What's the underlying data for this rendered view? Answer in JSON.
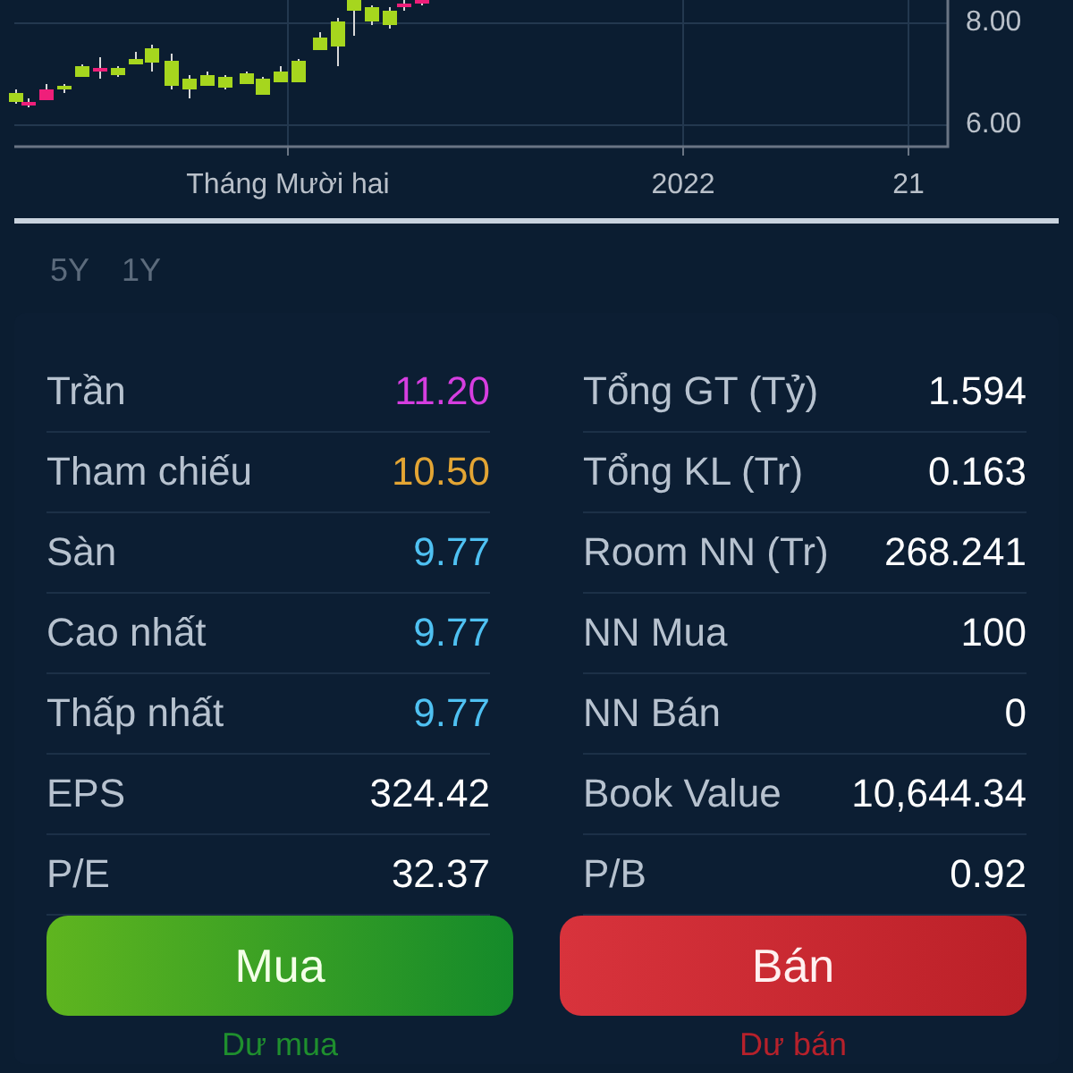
{
  "chart": {
    "y_labels": [
      "8.00",
      "6.00"
    ],
    "x_labels": [
      "Tháng Mười hai",
      "2022",
      "21"
    ]
  },
  "range_tabs": [
    {
      "label": "5Y",
      "selected": false
    },
    {
      "label": "1Y",
      "selected": false
    }
  ],
  "stats": [
    {
      "left": {
        "label": "Trần",
        "value": "11.20",
        "color": "#d63ee0"
      },
      "right": {
        "label": "Tổng GT (Tỷ)",
        "value": "1.594",
        "color": "#ffffff"
      }
    },
    {
      "left": {
        "label": "Tham chiếu",
        "value": "10.50",
        "color": "#e3a534"
      },
      "right": {
        "label": "Tổng KL (Tr)",
        "value": "0.163",
        "color": "#ffffff"
      }
    },
    {
      "left": {
        "label": "Sàn",
        "value": "9.77",
        "color": "#4fc1f2"
      },
      "right": {
        "label": "Room NN (Tr)",
        "value": "268.241",
        "color": "#ffffff"
      }
    },
    {
      "left": {
        "label": "Cao nhất",
        "value": "9.77",
        "color": "#4fc1f2"
      },
      "right": {
        "label": "NN Mua",
        "value": "100",
        "color": "#ffffff"
      }
    },
    {
      "left": {
        "label": "Thấp nhất",
        "value": "9.77",
        "color": "#4fc1f2"
      },
      "right": {
        "label": "NN Bán",
        "value": "0",
        "color": "#ffffff"
      }
    },
    {
      "left": {
        "label": "EPS",
        "value": "324.42",
        "color": "#ffffff"
      },
      "right": {
        "label": "Book Value",
        "value": "10,644.34",
        "color": "#ffffff"
      }
    },
    {
      "left": {
        "label": "P/E",
        "value": "32.37",
        "color": "#ffffff"
      },
      "right": {
        "label": "P/B",
        "value": "0.92",
        "color": "#ffffff"
      }
    }
  ],
  "actions": [
    {
      "label": "Mua",
      "kind": "buy",
      "sub": "Dư mua"
    },
    {
      "label": "Bán",
      "kind": "sell",
      "sub": "Dư bán"
    }
  ]
}
